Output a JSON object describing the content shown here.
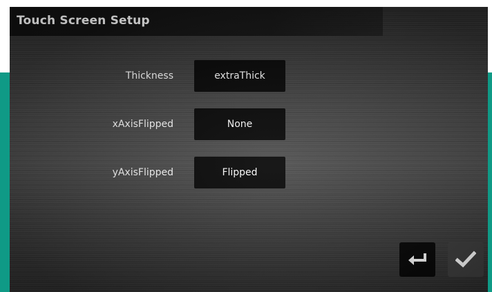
{
  "title": "Touch Screen Setup",
  "settings": [
    {
      "label": "Thickness",
      "value": "extraThick"
    },
    {
      "label": "xAxisFlipped",
      "value": "None"
    },
    {
      "label": "yAxisFlipped",
      "value": "Flipped"
    }
  ],
  "colors": {
    "accent": "#0f9a86",
    "button_bg": "#050505",
    "text": "#ffffff"
  },
  "icons": {
    "back": "return-arrow-icon",
    "confirm": "checkmark-icon"
  }
}
